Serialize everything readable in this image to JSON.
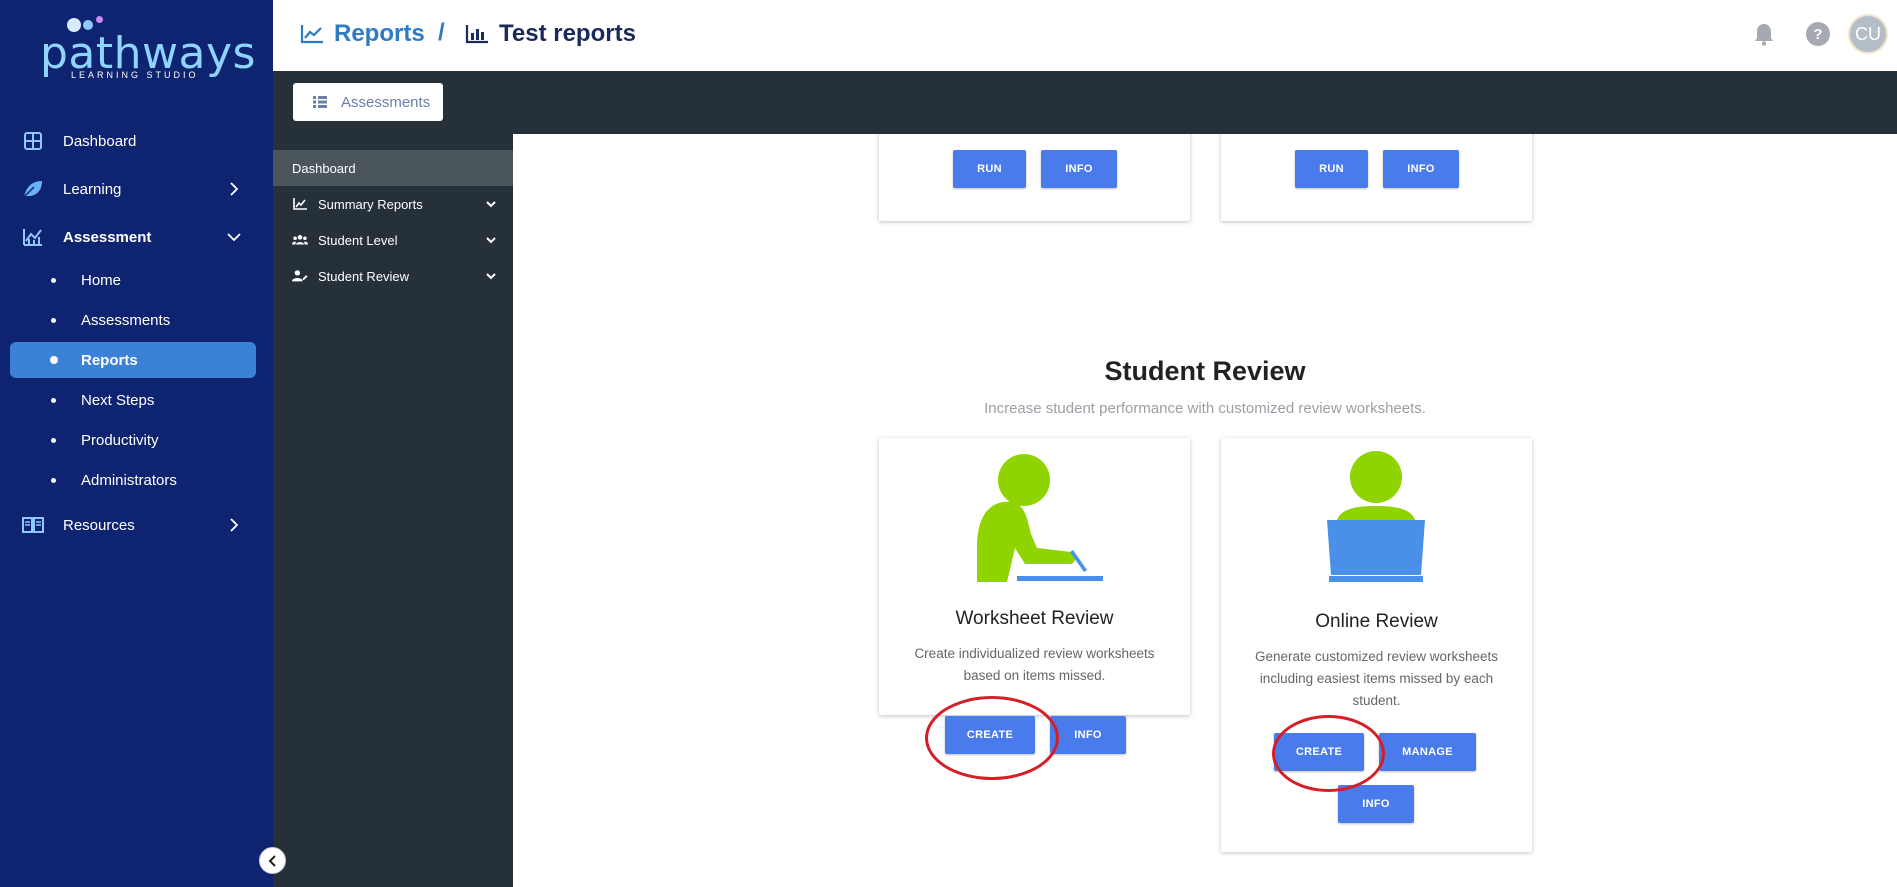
{
  "brand": {
    "name": "pathways",
    "tagline": "LEARNING STUDIO",
    "colors": {
      "nav_bg": "#0f2470",
      "accent": "#3b82d6",
      "button": "#4a7bec",
      "sub_bg": "#263038",
      "illustration": "#8fd400",
      "laptop": "#4a90e8",
      "highlight": "#d41f26"
    }
  },
  "leftnav": {
    "items": [
      {
        "label": "Dashboard",
        "icon": "grid-icon"
      },
      {
        "label": "Learning",
        "icon": "leaf-icon",
        "chevron": "chevron-right-icon"
      },
      {
        "label": "Assessment",
        "icon": "chart-line-icon",
        "chevron": "chevron-down-icon"
      },
      {
        "label": "Resources",
        "icon": "book-icon",
        "chevron": "chevron-right-icon"
      }
    ],
    "assessment_sub": [
      {
        "label": "Home"
      },
      {
        "label": "Assessments"
      },
      {
        "label": "Reports",
        "active": true
      },
      {
        "label": "Next Steps"
      },
      {
        "label": "Productivity"
      },
      {
        "label": "Administrators"
      }
    ]
  },
  "header": {
    "breadcrumb_root": "Reports",
    "separator": "/",
    "breadcrumb_current": "Test reports",
    "avatar_initials": "CU",
    "help_glyph": "?"
  },
  "subheader": {
    "tab_label": "Assessments"
  },
  "sidebar2": {
    "items": [
      {
        "label": "Dashboard",
        "active": true
      },
      {
        "label": "Summary Reports",
        "icon": "area-chart-icon"
      },
      {
        "label": "Student Level",
        "icon": "users-icon"
      },
      {
        "label": "Student Review",
        "icon": "user-edit-icon"
      }
    ]
  },
  "main": {
    "top_cards": [
      {
        "run_label": "RUN",
        "info_label": "INFO"
      },
      {
        "run_label": "RUN",
        "info_label": "INFO"
      }
    ],
    "section_title": "Student Review",
    "section_subtitle": "Increase student performance with customized review worksheets.",
    "cards": [
      {
        "title": "Worksheet Review",
        "description": "Create individualized review worksheets based on items missed.",
        "create_label": "CREATE",
        "info_label": "INFO"
      },
      {
        "title": "Online Review",
        "description": "Generate customized review worksheets including easiest items missed by each student.",
        "create_label": "CREATE",
        "manage_label": "MANAGE",
        "info_label": "INFO"
      }
    ]
  }
}
